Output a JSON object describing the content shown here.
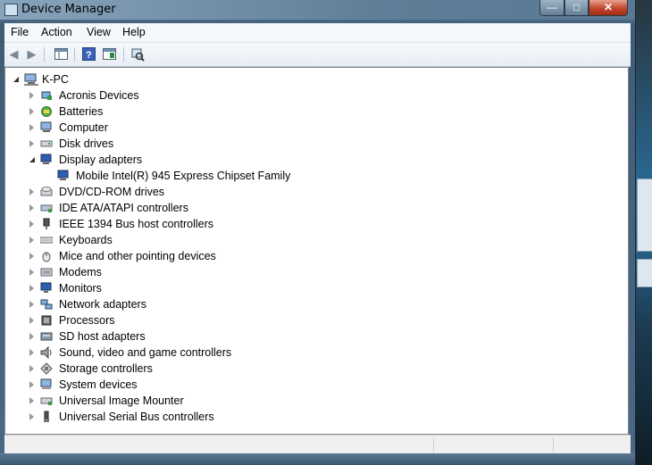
{
  "window": {
    "title": "Device Manager"
  },
  "caption_buttons": {
    "minimize": "—",
    "maximize": "□",
    "close": "✕"
  },
  "menu": [
    "File",
    "Action",
    "View",
    "Help"
  ],
  "toolbar": [
    "back-icon",
    "forward-icon",
    "show-hide-console-tree-icon",
    "help-icon",
    "properties-icon",
    "scan-hardware-icon"
  ],
  "tree": {
    "root": "K-PC",
    "items": [
      {
        "label": "Acronis Devices",
        "icon": "acronis-device-icon",
        "expanded": false
      },
      {
        "label": "Batteries",
        "icon": "battery-icon",
        "expanded": false
      },
      {
        "label": "Computer",
        "icon": "computer-icon",
        "expanded": false
      },
      {
        "label": "Disk drives",
        "icon": "disk-drive-icon",
        "expanded": false
      },
      {
        "label": "Display adapters",
        "icon": "display-adapter-icon",
        "expanded": true,
        "children": [
          {
            "label": "Mobile Intel(R) 945 Express Chipset Family",
            "icon": "display-adapter-icon"
          }
        ]
      },
      {
        "label": "DVD/CD-ROM drives",
        "icon": "dvd-drive-icon",
        "expanded": false
      },
      {
        "label": "IDE ATA/ATAPI controllers",
        "icon": "ide-controller-icon",
        "expanded": false
      },
      {
        "label": "IEEE 1394 Bus host controllers",
        "icon": "ieee1394-icon",
        "expanded": false
      },
      {
        "label": "Keyboards",
        "icon": "keyboard-icon",
        "expanded": false
      },
      {
        "label": "Mice and other pointing devices",
        "icon": "mouse-icon",
        "expanded": false
      },
      {
        "label": "Modems",
        "icon": "modem-icon",
        "expanded": false
      },
      {
        "label": "Monitors",
        "icon": "monitor-icon",
        "expanded": false
      },
      {
        "label": "Network adapters",
        "icon": "network-adapter-icon",
        "expanded": false
      },
      {
        "label": "Processors",
        "icon": "processor-icon",
        "expanded": false
      },
      {
        "label": "SD host adapters",
        "icon": "sd-host-icon",
        "expanded": false
      },
      {
        "label": "Sound, video and game controllers",
        "icon": "sound-icon",
        "expanded": false
      },
      {
        "label": "Storage controllers",
        "icon": "storage-controller-icon",
        "expanded": false
      },
      {
        "label": "System devices",
        "icon": "system-device-icon",
        "expanded": false
      },
      {
        "label": "Universal Image Mounter",
        "icon": "image-mounter-icon",
        "expanded": false
      },
      {
        "label": "Universal Serial Bus controllers",
        "icon": "usb-icon",
        "expanded": false
      }
    ]
  },
  "status": {
    "text": ""
  }
}
